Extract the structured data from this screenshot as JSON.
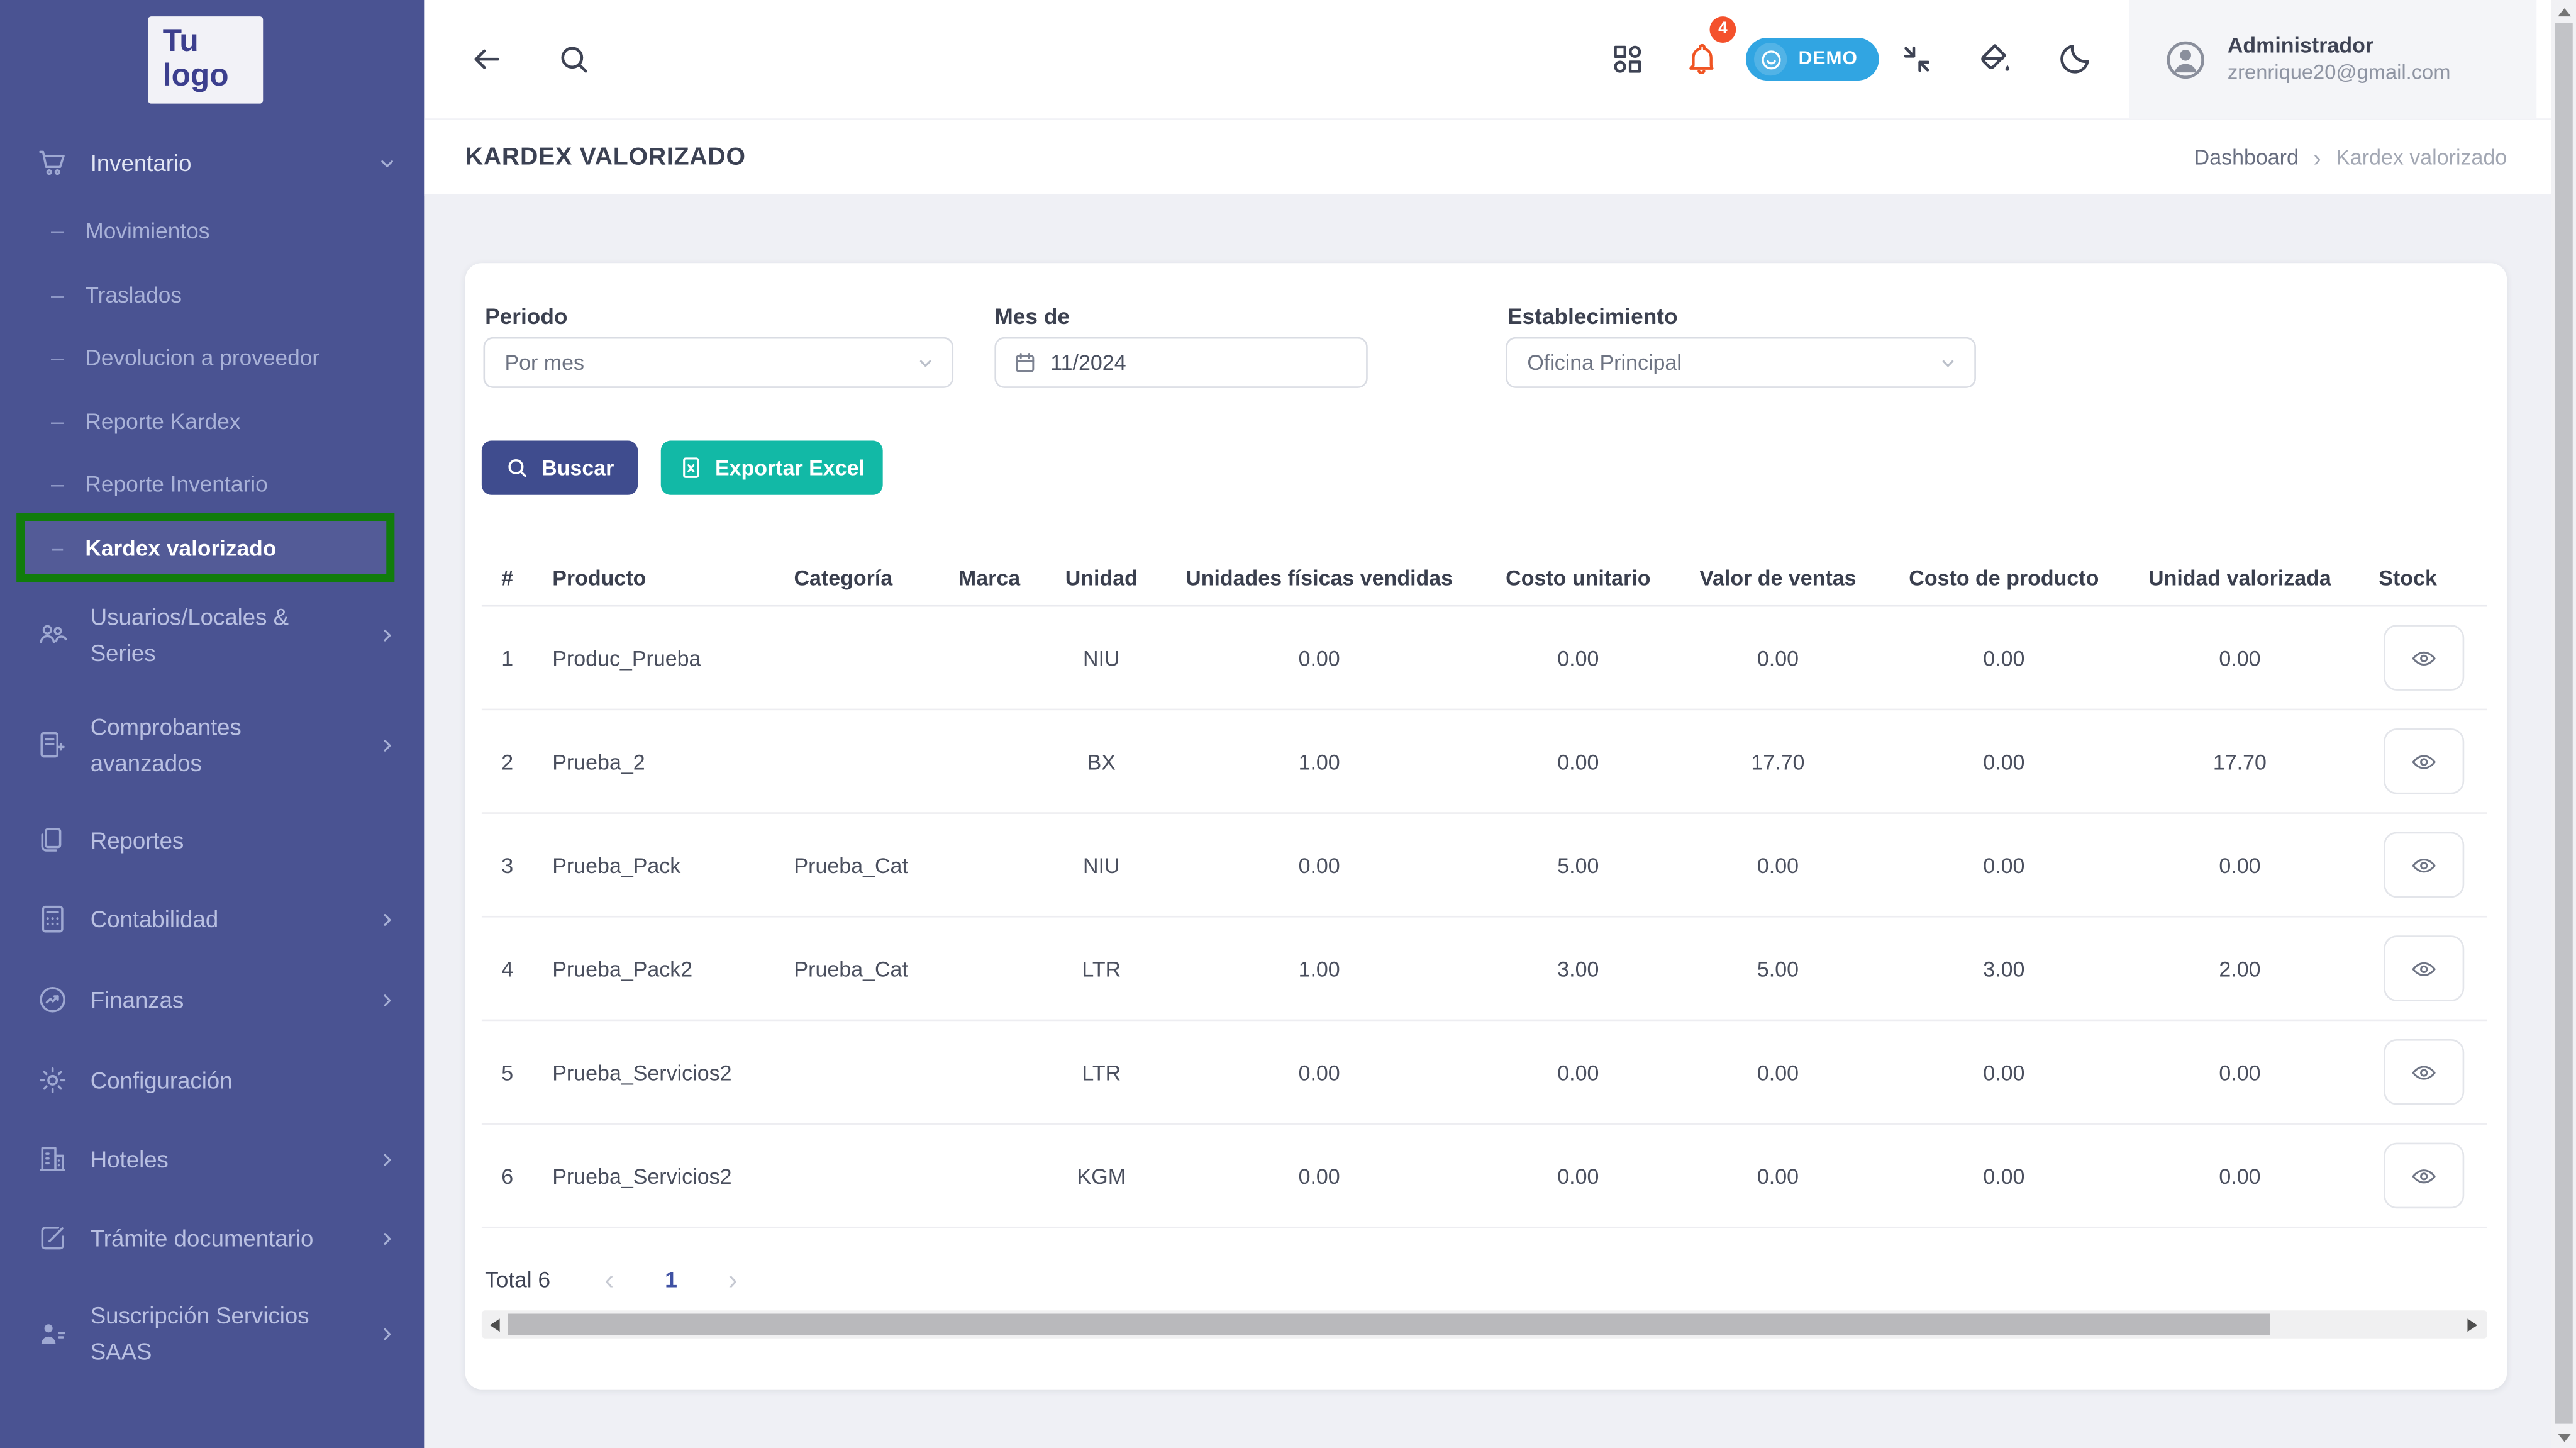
{
  "colors": {
    "sidebar_bg": "#4a5392",
    "annotation_green": "#117c0b",
    "buscar_btn": "#3f4c8e",
    "excel_btn": "#12b9a6",
    "demo_pill": "#31a5e2",
    "bell_orange": "#f05423",
    "badge_red": "#f4512c",
    "page_bg": "#eff0f5",
    "pagination_active": "#3f51a3"
  },
  "icons": {
    "back": "arrow-left-icon",
    "search": "search-icon",
    "apps": "apps-grid-icon",
    "notifications": "bell-icon",
    "demo": "smiley-icon",
    "compress": "compress-icon",
    "theme": "paint-bucket-icon",
    "dark_mode": "moon-icon",
    "user": "avatar-icon",
    "calendar": "calendar-icon",
    "view_row": "eye-icon",
    "excel": "excel-file-icon"
  },
  "sidebar": {
    "logo": {
      "line1": "Tu",
      "line2": "logo"
    },
    "bullet": "–",
    "inventario": {
      "label": "Inventario",
      "icon": "cart-icon"
    },
    "inventario_children": [
      {
        "label": "Movimientos"
      },
      {
        "label": "Traslados"
      },
      {
        "label": "Devolucion a proveedor"
      },
      {
        "label": "Reporte Kardex"
      },
      {
        "label": "Reporte Inventario"
      },
      {
        "label": "Kardex valorizado"
      }
    ],
    "items": [
      {
        "label": "Usuarios/Locales & Series",
        "icon": "users-icon"
      },
      {
        "label": "Comprobantes avanzados",
        "icon": "journal-icon"
      },
      {
        "label": "Reportes",
        "icon": "files-icon"
      },
      {
        "label": "Contabilidad",
        "icon": "calculator-icon"
      },
      {
        "label": "Finanzas",
        "icon": "trend-circle-icon"
      },
      {
        "label": "Configuración",
        "icon": "gear-icon"
      },
      {
        "label": "Hoteles",
        "icon": "building-icon"
      },
      {
        "label": "Trámite documentario",
        "icon": "document-edit-icon"
      },
      {
        "label": "Suscripción Servicios SAAS",
        "icon": "user-badge-icon"
      }
    ]
  },
  "topbar": {
    "notification_count": "4",
    "demo_label": "DEMO",
    "user": {
      "name": "Administrador",
      "email": "zrenrique20@gmail.com"
    }
  },
  "page_header": {
    "title": "KARDEX VALORIZADO",
    "breadcrumb_home": "Dashboard",
    "breadcrumb_sep": "›",
    "breadcrumb_current": "Kardex valorizado"
  },
  "filters": {
    "periodo": {
      "label": "Periodo",
      "value": "Por mes"
    },
    "mes": {
      "label": "Mes de",
      "value": "11/2024"
    },
    "establecimiento": {
      "label": "Establecimiento",
      "value": "Oficina Principal"
    }
  },
  "actions": {
    "buscar": "Buscar",
    "exportar": "Exportar Excel"
  },
  "table": {
    "headers": [
      "#",
      "Producto",
      "Categoría",
      "Marca",
      "Unidad",
      "Unidades físicas vendidas",
      "Costo unitario",
      "Valor de ventas",
      "Costo de producto",
      "Unidad valorizada",
      "Stock"
    ],
    "rows": [
      {
        "n": "1",
        "producto": "Produc_Prueba",
        "categoria": "",
        "marca": "",
        "unidad": "NIU",
        "unidades": "0.00",
        "costo_unitario": "0.00",
        "valor_ventas": "0.00",
        "costo_producto": "0.00",
        "unidad_valorizada": "0.00"
      },
      {
        "n": "2",
        "producto": "Prueba_2",
        "categoria": "",
        "marca": "",
        "unidad": "BX",
        "unidades": "1.00",
        "costo_unitario": "0.00",
        "valor_ventas": "17.70",
        "costo_producto": "0.00",
        "unidad_valorizada": "17.70"
      },
      {
        "n": "3",
        "producto": "Prueba_Pack",
        "categoria": "Prueba_Cat",
        "marca": "",
        "unidad": "NIU",
        "unidades": "0.00",
        "costo_unitario": "5.00",
        "valor_ventas": "0.00",
        "costo_producto": "0.00",
        "unidad_valorizada": "0.00"
      },
      {
        "n": "4",
        "producto": "Prueba_Pack2",
        "categoria": "Prueba_Cat",
        "marca": "",
        "unidad": "LTR",
        "unidades": "1.00",
        "costo_unitario": "3.00",
        "valor_ventas": "5.00",
        "costo_producto": "3.00",
        "unidad_valorizada": "2.00"
      },
      {
        "n": "5",
        "producto": "Prueba_Servicios2",
        "categoria": "",
        "marca": "",
        "unidad": "LTR",
        "unidades": "0.00",
        "costo_unitario": "0.00",
        "valor_ventas": "0.00",
        "costo_producto": "0.00",
        "unidad_valorizada": "0.00"
      },
      {
        "n": "6",
        "producto": "Prueba_Servicios2",
        "categoria": "",
        "marca": "",
        "unidad": "KGM",
        "unidades": "0.00",
        "costo_unitario": "0.00",
        "valor_ventas": "0.00",
        "costo_producto": "0.00",
        "unidad_valorizada": "0.00"
      }
    ]
  },
  "pagination": {
    "total": "Total 6",
    "prev": "‹",
    "page": "1",
    "next": "›"
  }
}
